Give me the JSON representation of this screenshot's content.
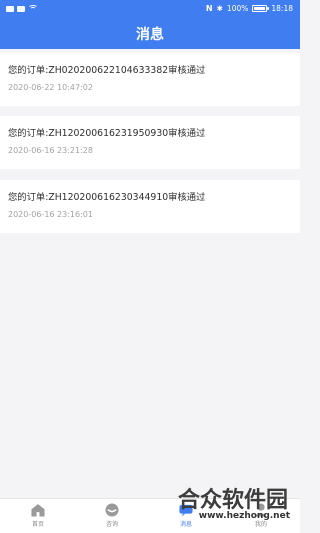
{
  "status_bar": {
    "nfc_label": "N",
    "battery_percent_text": "100%",
    "time": "18:18"
  },
  "header": {
    "title": "消息"
  },
  "messages": [
    {
      "title": "您的订单:ZH020200622104633382审核通过",
      "time": "2020-06-22 10:47:02"
    },
    {
      "title": "您的订单:ZH120200616231950930审核通过",
      "time": "2020-06-16 23:21:28"
    },
    {
      "title": "您的订单:ZH120200616230344910审核通过",
      "time": "2020-06-16 23:16:01"
    }
  ],
  "tabs": [
    {
      "label": "首页",
      "icon": "home-icon"
    },
    {
      "label": "咨询",
      "icon": "consult-icon"
    },
    {
      "label": "消息",
      "icon": "message-icon",
      "active": true
    },
    {
      "label": "我的",
      "icon": "profile-icon"
    }
  ],
  "watermark": {
    "main": "合众软件园",
    "url": "www.hezhong.net"
  },
  "colors": {
    "primary": "#3f7df0",
    "background": "#f4f4f6",
    "card": "#ffffff",
    "text": "#2f2f2f",
    "muted": "#a2a2a2"
  }
}
